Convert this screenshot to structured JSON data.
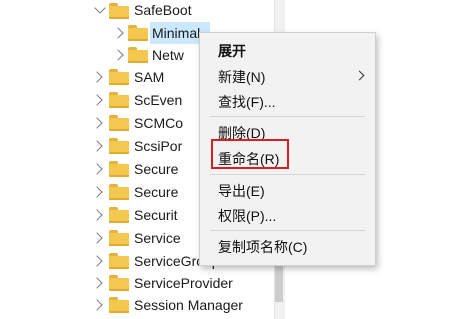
{
  "tree": {
    "items": [
      {
        "label": "SafeBoot",
        "expanded": true
      },
      {
        "label": "Minimal"
      },
      {
        "label": "Netw"
      },
      {
        "label": "SAM"
      },
      {
        "label": "ScEven"
      },
      {
        "label": "SCMCo"
      },
      {
        "label": "ScsiPor"
      },
      {
        "label": "Secure"
      },
      {
        "label": "Secure"
      },
      {
        "label": "Securit"
      },
      {
        "label": "Service"
      },
      {
        "label": "ServiceGroupOrder"
      },
      {
        "label": "ServiceProvider"
      },
      {
        "label": "Session Manager"
      }
    ]
  },
  "context_menu": {
    "expand": "展开",
    "new": "新建(N)",
    "find": "查找(F)...",
    "delete": "删除(D)",
    "rename": "重命名(R)",
    "export": "导出(E)",
    "permissions": "权限(P)...",
    "copy_key_name": "复制项名称(C)"
  },
  "colors": {
    "folder": "#f4c84e",
    "selection": "#cce8ff",
    "highlight_box": "#d52020"
  },
  "icons": {
    "folder": "folder-icon",
    "expand": "chevron-right-icon",
    "collapse": "chevron-down-icon",
    "submenu": "chevron-right-icon"
  }
}
